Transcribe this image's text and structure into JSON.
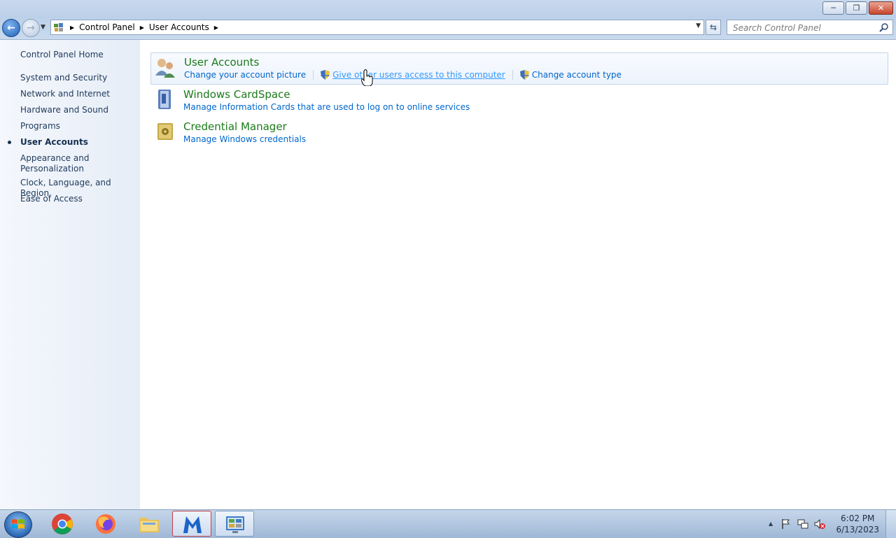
{
  "window": {
    "controls": {
      "minimize": "─",
      "restore": "❐",
      "close": "✕"
    }
  },
  "nav": {
    "back_glyph": "←",
    "forward_glyph": "→",
    "breadcrumbs": [
      "Control Panel",
      "User Accounts"
    ],
    "search_placeholder": "Search Control Panel",
    "refresh_glyph": "⇆"
  },
  "sidebar": {
    "items": [
      {
        "label": "Control Panel Home"
      },
      {
        "label": "System and Security"
      },
      {
        "label": "Network and Internet"
      },
      {
        "label": "Hardware and Sound"
      },
      {
        "label": "Programs"
      },
      {
        "label": "User Accounts",
        "active": true
      },
      {
        "label": "Appearance and Personalization"
      },
      {
        "label": "Clock, Language, and Region"
      },
      {
        "label": "Ease of Access"
      }
    ]
  },
  "groups": [
    {
      "title": "User Accounts",
      "tasks": [
        "Change your account picture",
        "Give other users access to this computer",
        "Change account type"
      ]
    },
    {
      "title": "Windows CardSpace",
      "tasks": [
        "Manage Information Cards that are used to log on to online services"
      ]
    },
    {
      "title": "Credential Manager",
      "tasks": [
        "Manage Windows credentials"
      ]
    }
  ],
  "taskbar": {
    "apps": [
      "chrome",
      "firefox",
      "file-explorer",
      "malwarebytes",
      "control-panel"
    ],
    "tray_expand": "▲",
    "clock_time": "6:02 PM",
    "clock_date": "6/13/2023"
  },
  "colors": {
    "group_title": "#1a7a1a",
    "task_link": "#0066cc",
    "sidebar_text": "#1e395b"
  }
}
